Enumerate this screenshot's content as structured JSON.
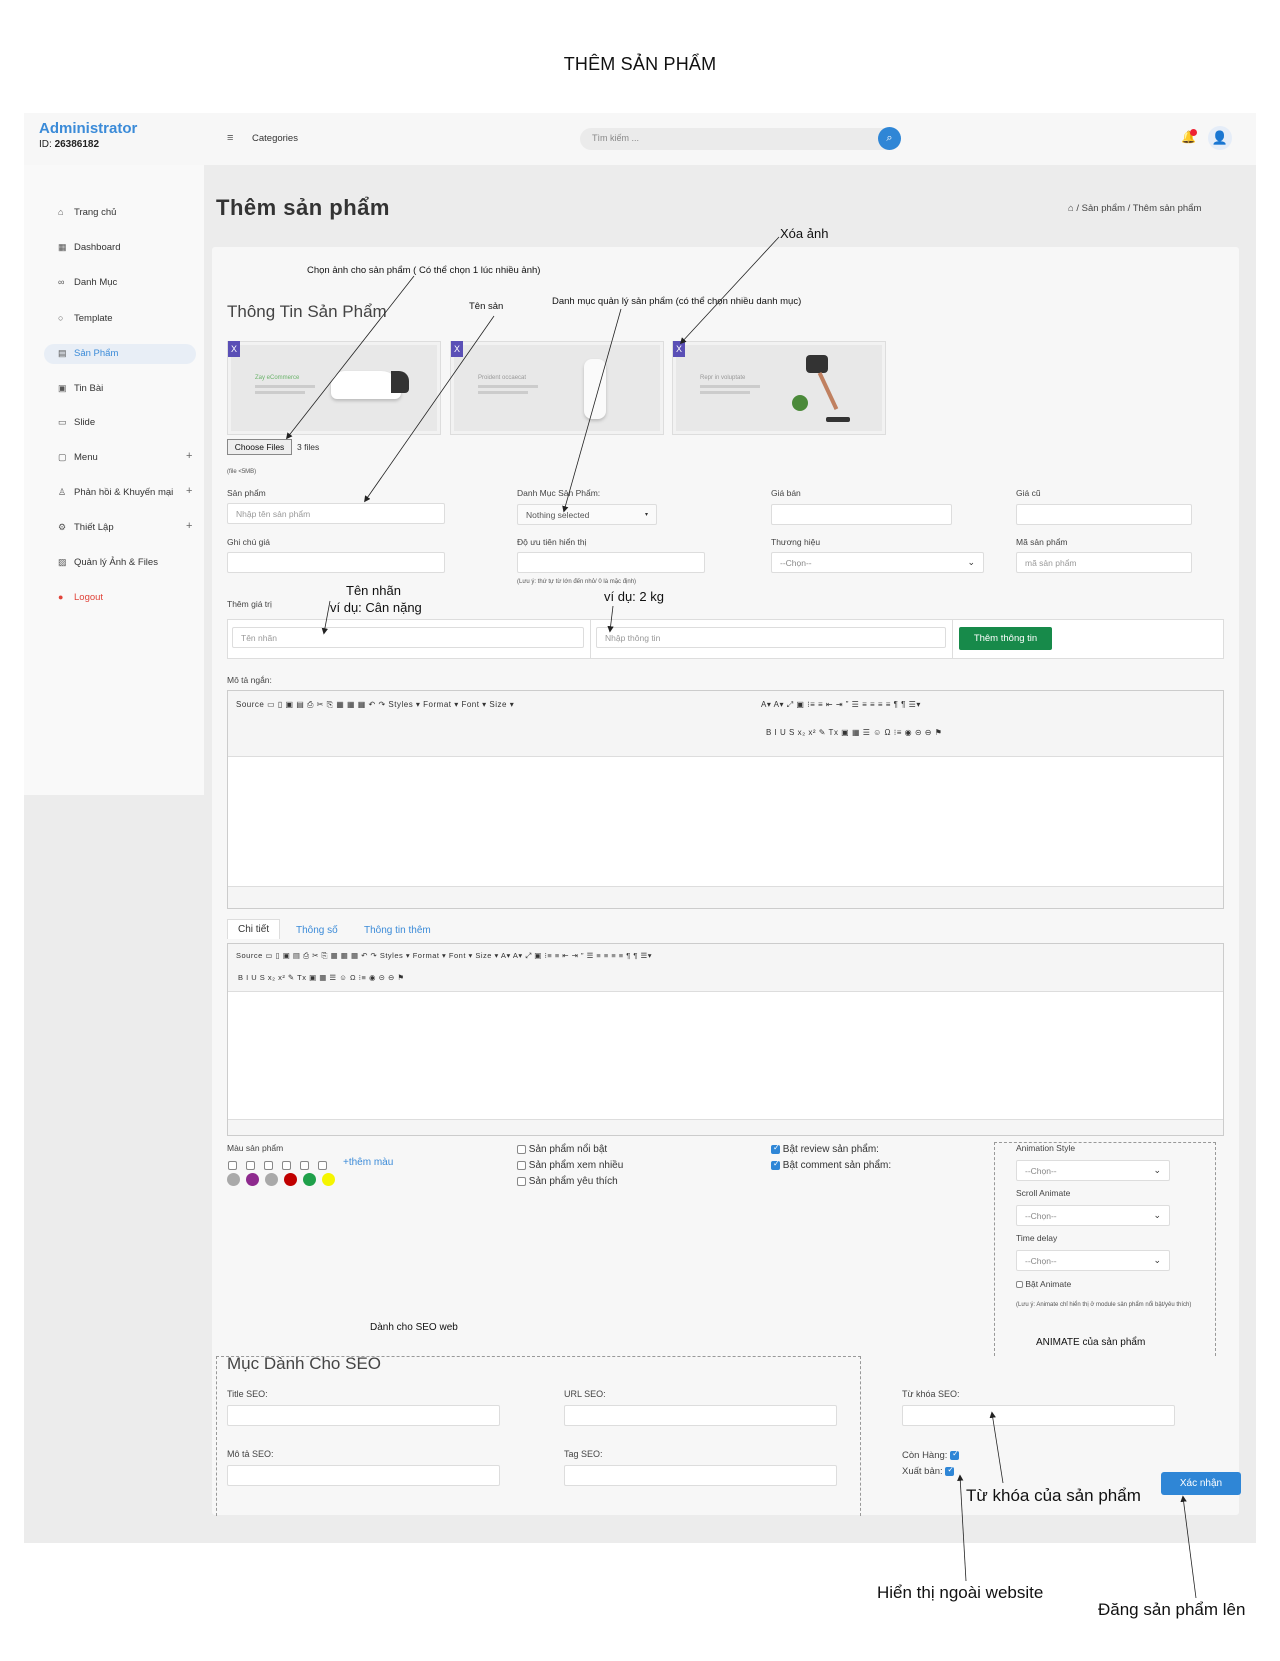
{
  "doc_title": "THÊM SẢN PHẨM",
  "header": {
    "brand": "Administrator",
    "id_label": "ID:",
    "id_value": "26386182",
    "categories": "Categories",
    "search_placeholder": "Tìm kiếm ..."
  },
  "sidebar": {
    "items": [
      {
        "label": "Trang chủ",
        "icon": "home-icon"
      },
      {
        "label": "Dashboard",
        "icon": "grid-icon"
      },
      {
        "label": "Danh Mục",
        "icon": "link-icon"
      },
      {
        "label": "Template",
        "icon": "circle-icon"
      },
      {
        "label": "Sản Phẩm",
        "icon": "product-icon"
      },
      {
        "label": "Tin Bài",
        "icon": "news-icon"
      },
      {
        "label": "Slide",
        "icon": "slide-icon"
      },
      {
        "label": "Menu",
        "icon": "menu-icon"
      },
      {
        "label": "Phản hồi & Khuyến mại",
        "icon": "user-icon"
      },
      {
        "label": "Thiết Lập",
        "icon": "gear-icon"
      },
      {
        "label": "Quản lý Ảnh & Files",
        "icon": "image-icon"
      },
      {
        "label": "Logout",
        "icon": "logout-icon"
      }
    ]
  },
  "page": {
    "title": "Thêm sản phẩm",
    "breadcrumb": "/ Sản phẩm / Thêm sản phẩm"
  },
  "product_info": {
    "section_title": "Thông Tin Sản Phẩm",
    "choose_files": "Choose Files",
    "files_count": "3 files",
    "file_note": "(file <5MB)",
    "images": [
      {
        "caption": "Zay eCommerce"
      },
      {
        "caption": "Proident occaecat"
      },
      {
        "caption": "Repr in voluptate"
      }
    ],
    "fields": {
      "name_label": "Sản phẩm",
      "name_placeholder": "Nhập tên sản phẩm",
      "category_label": "Danh Mục Sản Phẩm:",
      "category_value": "Nothing selected",
      "price_label": "Giá bán",
      "old_price_label": "Giá cũ",
      "price_note_label": "Ghi chú giá",
      "priority_label": "Độ ưu tiên hiển thị",
      "priority_note": "(Lưu ý: thứ tự từ lớn đến nhỏ/ 0 là mặc định)",
      "brand_label": "Thương hiệu",
      "brand_value": "--Chọn--",
      "code_label": "Mã sản phẩm",
      "code_placeholder": "mã sản phẩm",
      "attr_label": "Thêm giá trị",
      "attr_name_placeholder": "Tên nhãn",
      "attr_value_placeholder": "Nhập thông tin",
      "add_info_button": "Thêm thông tin",
      "short_desc_label": "Mô tả ngắn:"
    }
  },
  "editor_toolbar": {
    "row1": "Source  ▭ ▯ ▣ ▤ ⎙   ✂ ⎘ ▦ ▦ ▦   ↶ ↷   Styles  ▾   Format  ▾   Font  ▾   Size  ▾",
    "row1_right": "A▾ A▾ ⤢ ▣  ⁝≡ ≡  ⇤ ⇥ ” ☰  ≡ ≡ ≡ ≡  ¶ ¶ ☰▾",
    "row2": "B  I  U  S  x₂  x²  ✎  Tx  ▣ ▦ ☰ ☺ Ω ⁝≡ ◉  ⊝ ⊖ ⚑",
    "row1b": "Source  ▭ ▯ ▣ ▤ ⎙   ✂ ⎘ ▦ ▦ ▦   ↶ ↷   Styles  ▾   Format  ▾   Font  ▾   Size  ▾   A▾ A▾ ⤢ ▣  ⁝≡ ≡  ⇤ ⇥ ” ☰  ≡ ≡ ≡ ≡  ¶ ¶ ☰▾",
    "row2b": "B  I  U  S  x₂  x²  ✎  Tx  ▣ ▦ ☰ ☺ Ω ⁝≡ ◉  ⊝ ⊖ ⚑"
  },
  "tabs": [
    {
      "label": "Chi tiết",
      "active": true
    },
    {
      "label": "Thông số",
      "active": false
    },
    {
      "label": "Thông tin thêm",
      "active": false
    }
  ],
  "options": {
    "color_label": "Màu sản phẩm",
    "add_color": "+thêm màu",
    "colors": [
      "#a9a9a9",
      "#8e2a8e",
      "#a9a9a9",
      "#c00000",
      "#1fa04a",
      "#f5f500"
    ],
    "flags": [
      {
        "label": "Sản phẩm nổi bật",
        "checked": false
      },
      {
        "label": "Sản phẩm xem nhiều",
        "checked": false
      },
      {
        "label": "Sản phẩm yêu thích",
        "checked": false
      }
    ],
    "reviews": [
      {
        "label": "Bật review sản phẩm:",
        "checked": true
      },
      {
        "label": "Bật comment sản phẩm:",
        "checked": true
      }
    ]
  },
  "animate": {
    "style_label": "Animation Style",
    "scroll_label": "Scroll Animate",
    "delay_label": "Time delay",
    "select_value": "--Chọn--",
    "enable_label": "Bật Animate",
    "note": "(Lưu ý: Animate chỉ hiển thị ở module sản phẩm nổi bật/yêu thích)"
  },
  "seo": {
    "section_title": "Mục Dành Cho SEO",
    "title_label": "Title SEO:",
    "url_label": "URL SEO:",
    "keywords_label": "Từ khóa SEO:",
    "desc_label": "Mô tả SEO:",
    "tag_label": "Tag SEO:",
    "in_stock_label": "Còn Hàng:",
    "publish_label": "Xuất bản:",
    "confirm_button": "Xác nhận"
  },
  "annotations": {
    "choose_images": "Chọn ảnh cho sản phẩm ( Có thể chọn 1 lúc nhiều ảnh)",
    "product_name": "Tên sản",
    "category_manage": "Danh mục quản lý sản phẩm (có thể chọn nhiều danh mục)",
    "delete_image": "Xóa ảnh",
    "label_name": "Tên nhãn",
    "label_example": "ví dụ: Cân nặng",
    "value_example": "ví dụ: 2 kg",
    "seo_web": "Dành cho SEO web",
    "animate_product": "ANIMATE của sản phẩm",
    "product_keywords": "Từ khóa của sản phẩm",
    "show_outside": "Hiển thị ngoài website",
    "publish_product": "Đăng sản phẩm lên"
  }
}
